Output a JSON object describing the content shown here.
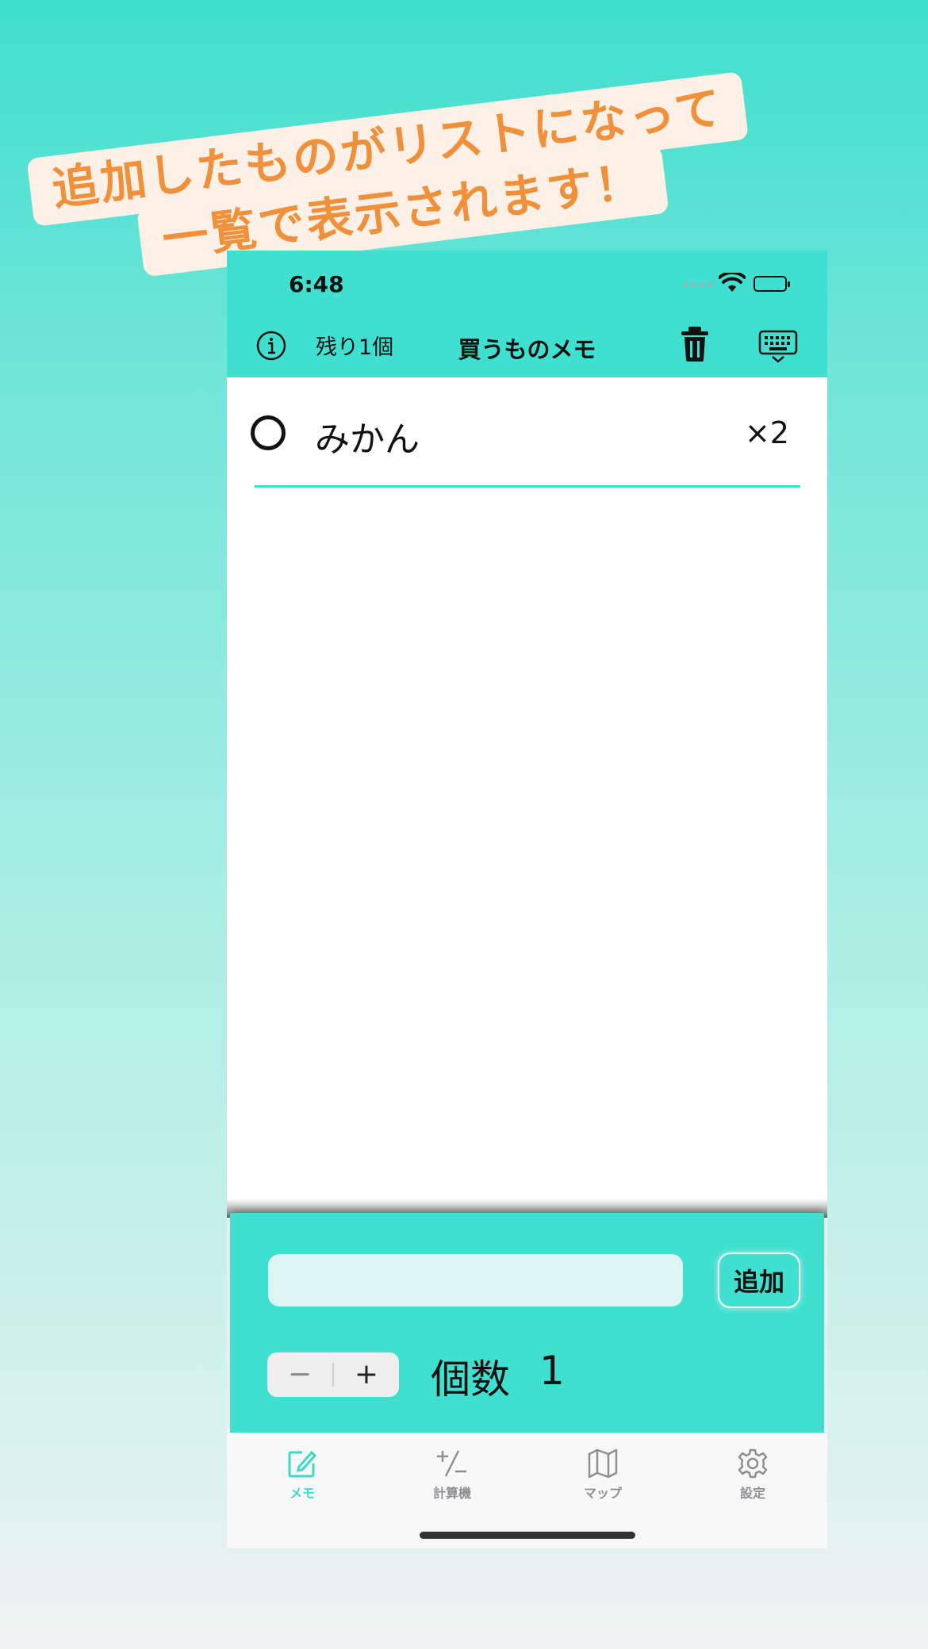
{
  "banner": {
    "line1": "追加したものがリストになって",
    "line2": "一覧で表示されます！"
  },
  "status_bar": {
    "time": "6:48",
    "icons": [
      "cellular-signal-icon",
      "wifi-icon",
      "battery-icon"
    ]
  },
  "nav_bar": {
    "info_icon": "info-icon",
    "remaining_label": "残り1個",
    "title": "買うものメモ",
    "trash_icon": "trash-icon",
    "keyboard_icon": "keyboard-dismiss-icon"
  },
  "list": {
    "items": [
      {
        "name": "みかん",
        "quantity": "×2",
        "checked": false
      }
    ]
  },
  "input_panel": {
    "input_value": "",
    "input_placeholder": "",
    "add_button_label": "追加",
    "stepper": {
      "minus": "−",
      "plus": "+"
    },
    "quantity_label": "個数",
    "quantity_value": "1"
  },
  "tab_bar": {
    "tabs": [
      {
        "label": "メモ",
        "icon": "memo-edit-icon",
        "active": true
      },
      {
        "label": "計算機",
        "icon": "plus-minus-icon",
        "active": false
      },
      {
        "label": "マップ",
        "icon": "map-icon",
        "active": false
      },
      {
        "label": "設定",
        "icon": "gear-icon",
        "active": false
      }
    ]
  },
  "colors": {
    "accent": "#3fe0d0",
    "banner_text": "#f0903a",
    "banner_bg": "#fdf0e6",
    "tab_active": "#3fd8c8",
    "tab_inactive": "#8e8e93"
  }
}
